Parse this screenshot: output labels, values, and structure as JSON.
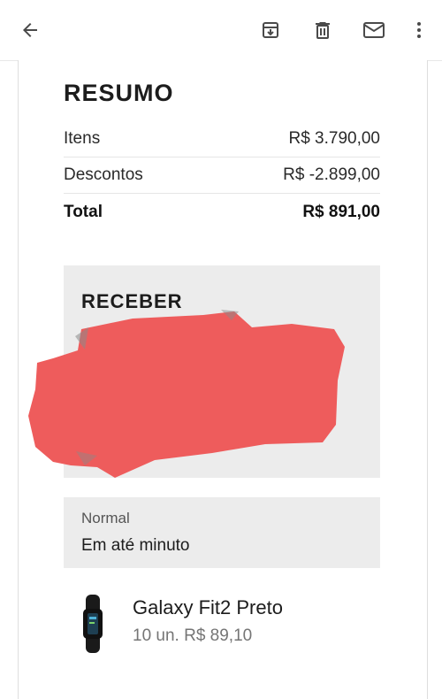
{
  "toolbar": {
    "back_icon": "arrow-left-icon",
    "archive_icon": "archive-icon",
    "delete_icon": "trash-icon",
    "mark_unread_icon": "mail-icon",
    "more_icon": "more-vert-icon"
  },
  "summary": {
    "title": "RESUMO",
    "rows": [
      {
        "label": "Itens",
        "value": "R$ 3.790,00"
      },
      {
        "label": "Descontos",
        "value": "R$ -2.899,00"
      },
      {
        "label": "Total",
        "value": "R$ 891,00"
      }
    ]
  },
  "receive": {
    "title": "RECEBER",
    "redaction_color": "#ee5c5c"
  },
  "shipping": {
    "type": "Normal",
    "time": "Em até minuto"
  },
  "product": {
    "name": "Galaxy Fit2 Preto",
    "quantity_price": "10 un. R$ 89,10"
  },
  "colors": {
    "icon": "#4a4a4a",
    "panel_bg": "#ececec",
    "redaction": "#ee5c5c"
  }
}
